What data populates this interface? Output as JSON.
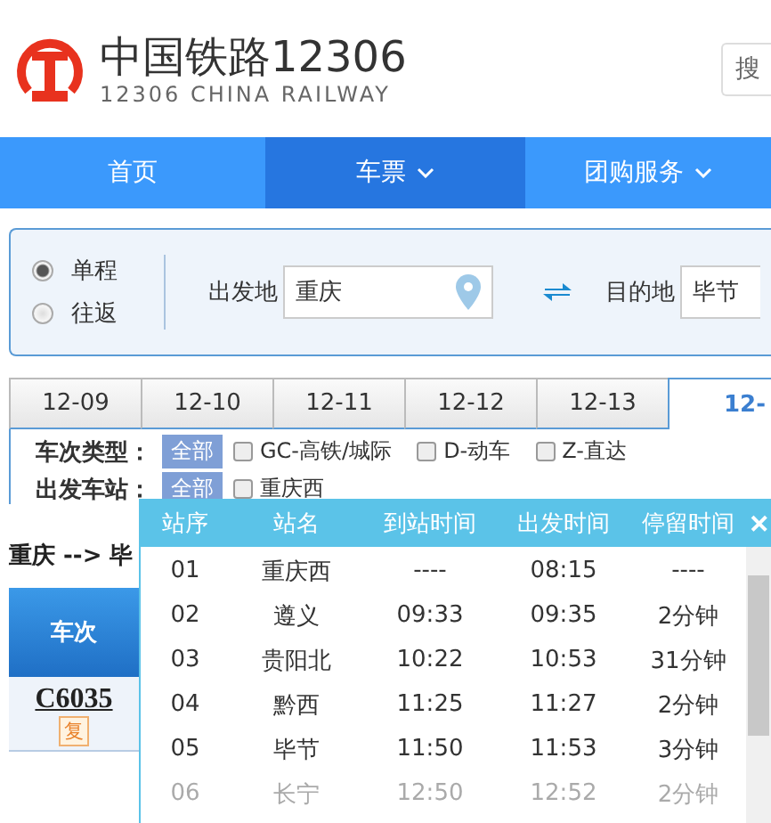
{
  "header": {
    "logo_title": "中国铁路12306",
    "logo_subtitle": "12306 CHINA RAILWAY",
    "search_placeholder": "搜"
  },
  "nav": [
    {
      "label": "首页",
      "selected": false,
      "dropdown": false
    },
    {
      "label": "车票",
      "selected": true,
      "dropdown": true
    },
    {
      "label": "团购服务",
      "selected": false,
      "dropdown": true
    }
  ],
  "trip_types": [
    {
      "label": "单程",
      "selected": true
    },
    {
      "label": "往返",
      "selected": false
    }
  ],
  "from": {
    "label": "出发地",
    "value": "重庆"
  },
  "to": {
    "label": "目的地",
    "value": "毕节"
  },
  "dates": [
    {
      "label": "12-09",
      "selected": false
    },
    {
      "label": "12-10",
      "selected": false
    },
    {
      "label": "12-11",
      "selected": false
    },
    {
      "label": "12-12",
      "selected": false
    },
    {
      "label": "12-13",
      "selected": false
    },
    {
      "label": "12-",
      "selected": true
    }
  ],
  "filters": [
    {
      "label": "车次类型：",
      "all": "全部",
      "options": [
        {
          "label": "GC-高铁/城际",
          "checked": false
        },
        {
          "label": "D-动车",
          "checked": false
        },
        {
          "label": "Z-直达",
          "checked": false
        }
      ]
    },
    {
      "label": "出发车站：",
      "all": "全部",
      "options": [
        {
          "label": "重庆西",
          "checked": false
        }
      ]
    }
  ],
  "route": "重庆 --> 毕",
  "table": {
    "column": "车次",
    "train": "C6035",
    "badge": "复"
  },
  "stops": {
    "columns": [
      "站序",
      "站名",
      "到站时间",
      "出发时间",
      "停留时间"
    ],
    "close": "✕",
    "rows": [
      {
        "no": "01",
        "station": "重庆西",
        "arrive": "----",
        "depart": "08:15",
        "stop": "----",
        "muted": false
      },
      {
        "no": "02",
        "station": "遵义",
        "arrive": "09:33",
        "depart": "09:35",
        "stop": "2分钟",
        "muted": false
      },
      {
        "no": "03",
        "station": "贵阳北",
        "arrive": "10:22",
        "depart": "10:53",
        "stop": "31分钟",
        "muted": false
      },
      {
        "no": "04",
        "station": "黔西",
        "arrive": "11:25",
        "depart": "11:27",
        "stop": "2分钟",
        "muted": false
      },
      {
        "no": "05",
        "station": "毕节",
        "arrive": "11:50",
        "depart": "11:53",
        "stop": "3分钟",
        "muted": false
      },
      {
        "no": "06",
        "station": "长宁",
        "arrive": "12:50",
        "depart": "12:52",
        "stop": "2分钟",
        "muted": true
      }
    ]
  }
}
